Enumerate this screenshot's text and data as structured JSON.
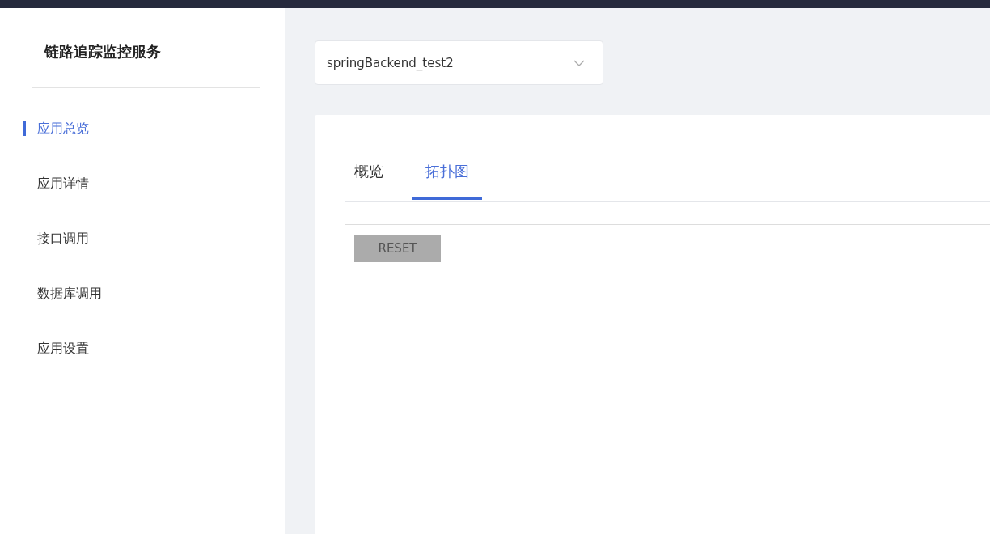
{
  "sidebar": {
    "title": "链路追踪监控服务",
    "items": [
      {
        "label": "应用总览",
        "selected": true
      },
      {
        "label": "应用详情",
        "selected": false
      },
      {
        "label": "接口调用",
        "selected": false
      },
      {
        "label": "数据库调用",
        "selected": false
      },
      {
        "label": "应用设置",
        "selected": false
      }
    ]
  },
  "app_select": {
    "value": "springBackend_test2"
  },
  "tabs": [
    {
      "label": "概览",
      "selected": false
    },
    {
      "label": "拓扑图",
      "selected": true
    }
  ],
  "topology": {
    "reset_button": "RESET"
  }
}
